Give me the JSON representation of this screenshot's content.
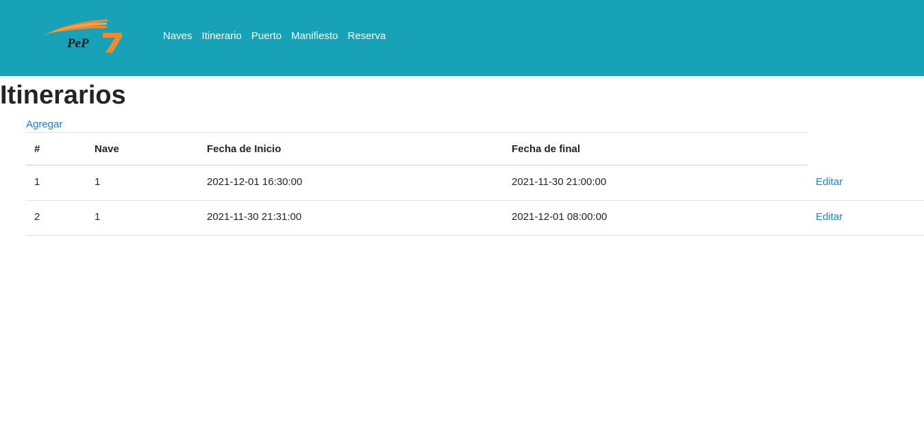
{
  "header": {
    "logo_text": "PeP",
    "nav": [
      "Naves",
      "Itinerario",
      "Puerto",
      "Manifiesto",
      "Reserva"
    ],
    "colors": {
      "navbar": "#17a2b8",
      "logo_orange": "#f08a2c"
    }
  },
  "main": {
    "title": "Itinerarios",
    "add_label": "Agregar",
    "table": {
      "columns": [
        "#",
        "Nave",
        "Fecha de Inicio",
        "Fecha de final"
      ],
      "rows": [
        {
          "id": "1",
          "nave": "1",
          "inicio": "2021-12-01 16:30:00",
          "final": "2021-11-30 21:00:00",
          "action": "Editar"
        },
        {
          "id": "2",
          "nave": "1",
          "inicio": "2021-11-30 21:31:00",
          "final": "2021-12-01 08:00:00",
          "action": "Editar"
        }
      ]
    }
  }
}
